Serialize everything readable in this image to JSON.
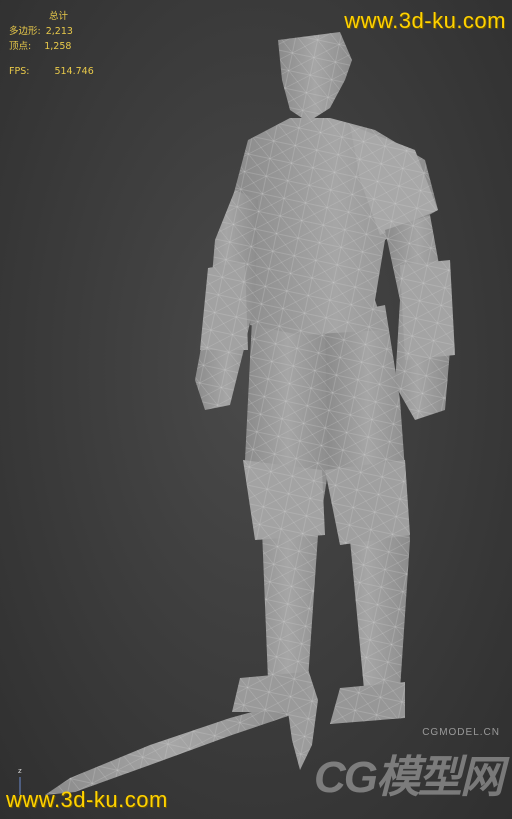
{
  "stats": {
    "title": "总计",
    "polygons_label": "多边形:",
    "polygons_value": "2,213",
    "vertices_label": "顶点:",
    "vertices_value": "1,258",
    "fps_label": "FPS:",
    "fps_value": "514.746"
  },
  "watermark": {
    "top": "www.3d-ku.com",
    "bottom": "www.3d-ku.com",
    "logo_small": "CGMODEL.CN",
    "logo_big": "CG模型网"
  },
  "axis": {
    "z_label": "z"
  },
  "colors": {
    "stats_text": "#e8c94a",
    "watermark": "#ffd200",
    "mesh_fill": "#9a9a9a",
    "mesh_wire": "#c8c8c8"
  }
}
